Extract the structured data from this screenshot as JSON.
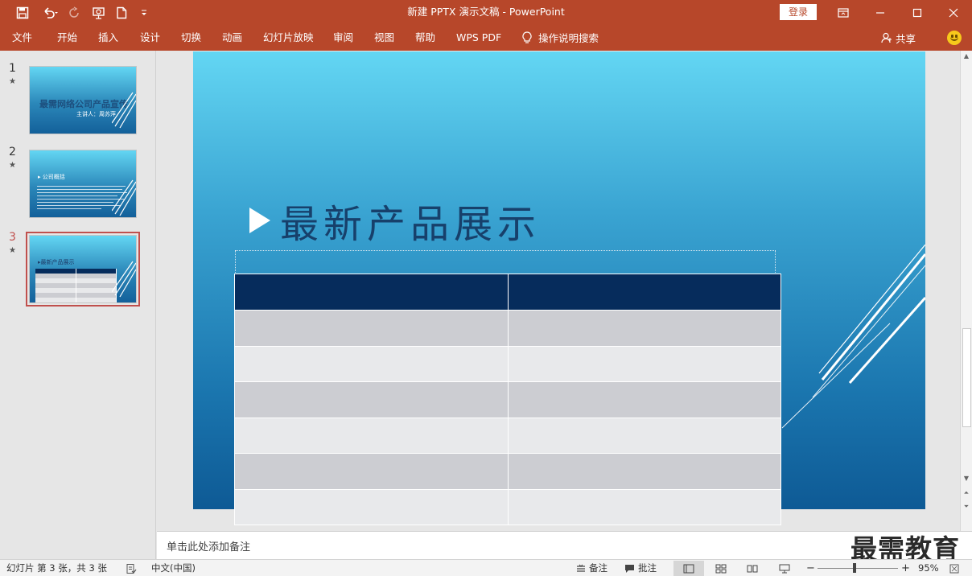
{
  "window": {
    "title": "新建 PPTX 演示文稿 - PowerPoint",
    "login_label": "登录"
  },
  "quick_access": {
    "icons": [
      "save-icon",
      "undo-icon",
      "redo-icon",
      "present-icon",
      "new-file-icon",
      "customize-icon"
    ]
  },
  "ribbon": {
    "tabs": [
      {
        "label": "文件"
      },
      {
        "label": "开始"
      },
      {
        "label": "插入"
      },
      {
        "label": "设计"
      },
      {
        "label": "切换"
      },
      {
        "label": "动画"
      },
      {
        "label": "幻灯片放映"
      },
      {
        "label": "审阅"
      },
      {
        "label": "视图"
      },
      {
        "label": "帮助"
      },
      {
        "label": "WPS PDF"
      }
    ],
    "search_label": "操作说明搜索",
    "share_label": "共享"
  },
  "thumbnails": [
    {
      "number": "1",
      "title": "最需网络公司产品宣传",
      "subtitle": "主讲人：周苏萍"
    },
    {
      "number": "2",
      "title": "公司概括"
    },
    {
      "number": "3",
      "title": "最新产品展示",
      "selected": true
    }
  ],
  "slide": {
    "title": "最新产品展示",
    "table": {
      "columns": 2,
      "rows": 7
    }
  },
  "notes": {
    "placeholder": "单击此处添加备注"
  },
  "watermark": "最需教育",
  "status_bar": {
    "slide_info": "幻灯片 第 3 张，共 3 张",
    "language": "中文(中国)",
    "notes_label": "备注",
    "comments_label": "批注",
    "zoom_minus": "−",
    "zoom_plus": "+",
    "zoom": "95%"
  },
  "colors": {
    "brand": "#b7472a",
    "table_header": "#062c5c",
    "table_row_dark": "#cccdd2",
    "table_row_light": "#e8e9eb",
    "slide_title": "#17406b"
  }
}
